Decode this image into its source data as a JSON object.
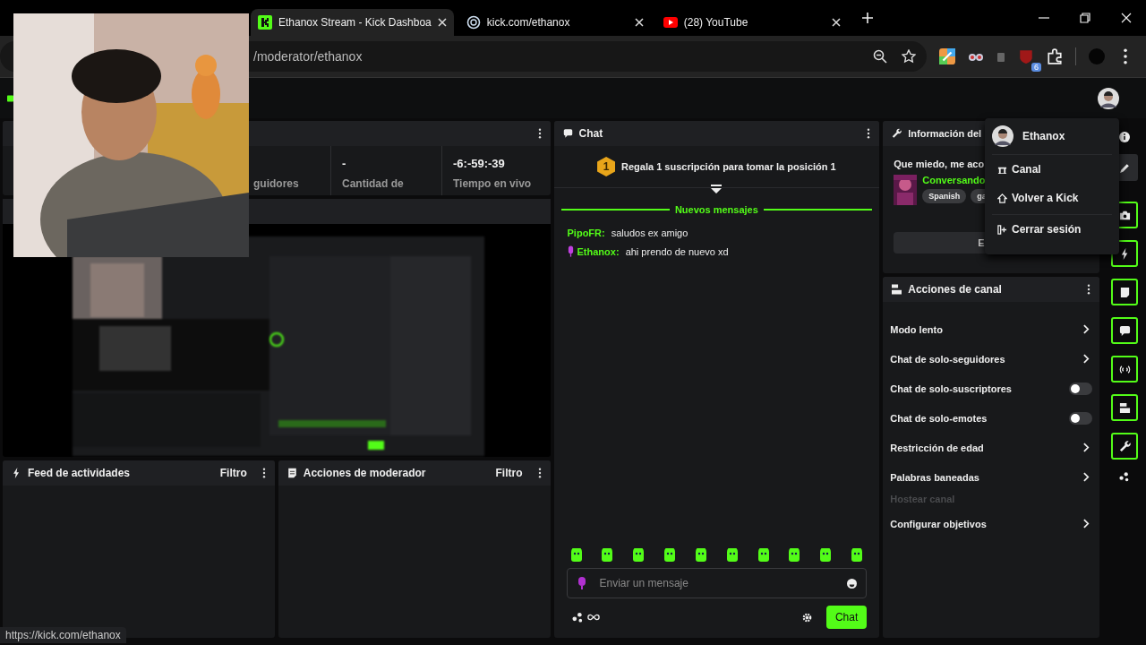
{
  "browser": {
    "tabs": [
      {
        "title": "Ethanox Stream - Kick Dashboa",
        "selected": true
      },
      {
        "title": "kick.com/ethanox",
        "selected": false
      },
      {
        "title": "(28) YouTube",
        "selected": false
      }
    ],
    "address": "/moderator/ethanox",
    "extension_badge": "6"
  },
  "stats": {
    "cells": [
      {
        "label": "guidores"
      },
      {
        "value": "-",
        "label": "Cantidad de"
      },
      {
        "value": "-6:-59:-39",
        "label": "Tiempo en vivo"
      }
    ]
  },
  "chat": {
    "title": "Chat",
    "pinned": {
      "badge": "1",
      "text": "Regala 1 suscripción para tomar la posición 1"
    },
    "new_messages": "Nuevos mensajes",
    "messages": [
      {
        "user": "PipoFR:",
        "text": "saludos ex amigo",
        "mic_badge": false
      },
      {
        "user": "Ethanox:",
        "text": "ahi prendo de nuevo xd",
        "mic_badge": true
      }
    ],
    "placeholder": "Enviar un mensaje",
    "send": "Chat"
  },
  "stream_info": {
    "title": "Información del",
    "stream_title": "Que miedo, me aco",
    "category": "Conversando",
    "tags": [
      "Spanish",
      "ga"
    ],
    "button": "E"
  },
  "channel_actions": {
    "title": "Acciones de canal",
    "items": [
      {
        "label": "Modo lento",
        "kind": "link"
      },
      {
        "label": "Chat de solo-seguidores",
        "kind": "link"
      },
      {
        "label": "Chat de solo-suscriptores",
        "kind": "toggle",
        "on": false
      },
      {
        "label": "Chat de solo-emotes",
        "kind": "toggle",
        "on": false
      },
      {
        "label": "Restricción de edad",
        "kind": "link"
      },
      {
        "label": "Palabras baneadas",
        "kind": "link"
      },
      {
        "label": "Hostear canal",
        "kind": "disabled"
      },
      {
        "label": "Configurar objetivos",
        "kind": "link"
      }
    ]
  },
  "panels": [
    {
      "title": "Feed de actividades",
      "filter": "Filtro"
    },
    {
      "title": "Acciones de moderador",
      "filter": "Filtro"
    }
  ],
  "user_menu": {
    "name": "Ethanox",
    "items": [
      {
        "kind": "channel",
        "label": "Canal"
      },
      {
        "kind": "home",
        "label": "Volver a Kick"
      },
      {
        "kind": "logout",
        "label": "Cerrar sesión"
      }
    ]
  },
  "status_url": "https://kick.com/ethanox"
}
